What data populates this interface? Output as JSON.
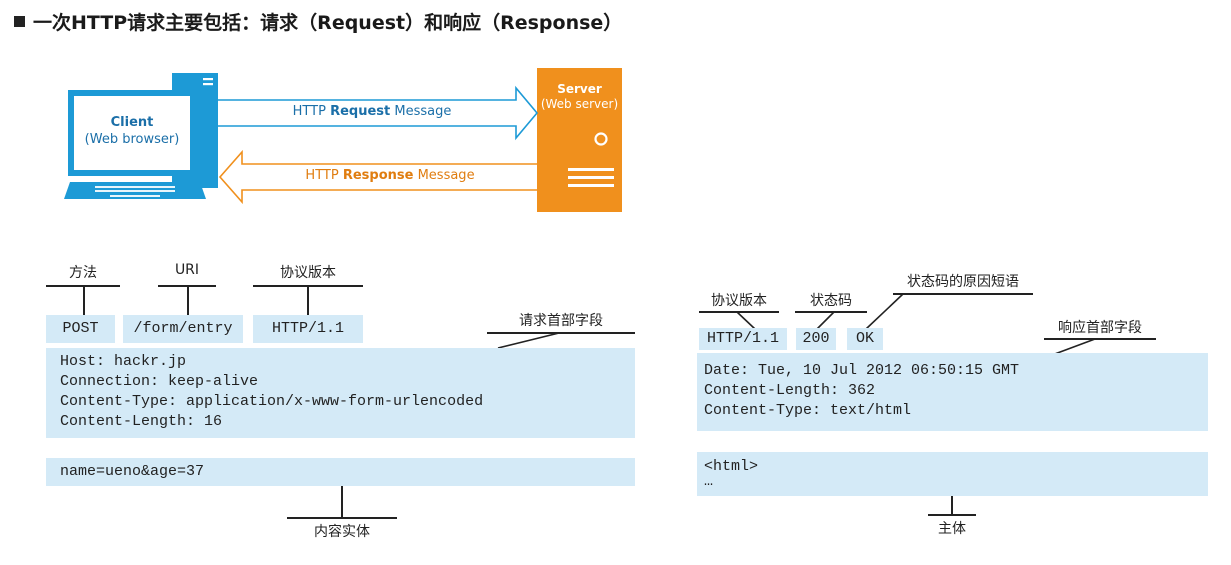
{
  "heading": "一次HTTP请求主要包括：请求（Request）和响应（Response）",
  "client": {
    "title": "Client",
    "subtitle": "(Web browser)"
  },
  "server": {
    "title": "Server",
    "subtitle": "(Web server)"
  },
  "request_arrow": {
    "prefix": "HTTP ",
    "bold": "Request",
    "suffix": " Message"
  },
  "response_arrow": {
    "prefix": "HTTP ",
    "bold": "Response",
    "suffix": " Message"
  },
  "request": {
    "labels": {
      "method": "方法",
      "uri": "URI",
      "version": "协议版本",
      "headers": "请求首部字段",
      "body": "内容实体"
    },
    "line": {
      "method": "POST",
      "uri": "/form/entry",
      "version": "HTTP/1.1"
    },
    "headers": [
      "Host: hackr.jp",
      "Connection: keep-alive",
      "Content-Type: application/x-www-form-urlencoded",
      "Content-Length: 16"
    ],
    "body": "name=ueno&age=37"
  },
  "response": {
    "labels": {
      "version": "协议版本",
      "status": "状态码",
      "reason": "状态码的原因短语",
      "headers": "响应首部字段",
      "body": "主体"
    },
    "line": {
      "version": "HTTP/1.1",
      "status": "200",
      "reason": "OK"
    },
    "headers": [
      "Date: Tue, 10 Jul 2012 06:50:15 GMT",
      "Content-Length: 362",
      "Content-Type: text/html"
    ],
    "body": [
      "<html>",
      "…"
    ]
  },
  "colors": {
    "blue": "#1d9ad6",
    "orange": "#f0901d",
    "box": "#d4eaf7",
    "client_text": "#1b6fa8"
  }
}
